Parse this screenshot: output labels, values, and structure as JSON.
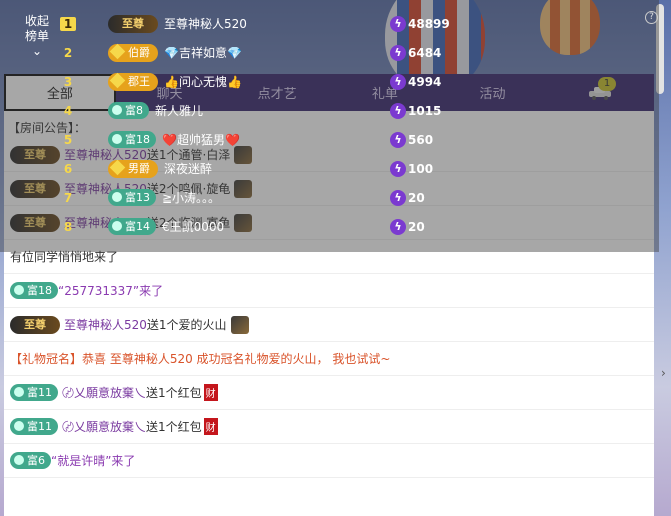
{
  "tabs": [
    {
      "label": "全部"
    },
    {
      "label": "聊天"
    },
    {
      "label": "点才艺"
    },
    {
      "label": "礼单"
    },
    {
      "label": "活动"
    },
    {
      "label": "",
      "badge": "1"
    }
  ],
  "announcement": "【房间公告】：",
  "overlay": {
    "collapse_label": "收起\n榜单",
    "rows": [
      {
        "rank": "1",
        "badge": "至尊",
        "badge_type": "zz",
        "name": "至尊神秘人520",
        "value": "48899"
      },
      {
        "rank": "2",
        "badge": "伯爵",
        "badge_type": "noble",
        "name": "💎吉祥如意💎",
        "value": "6484"
      },
      {
        "rank": "3",
        "badge": "郡王",
        "badge_type": "noble",
        "name": "👍问心无愧👍",
        "value": "4994"
      },
      {
        "rank": "4",
        "badge": "富8",
        "badge_type": "fu",
        "name": "新人雅儿",
        "value": "1015"
      },
      {
        "rank": "5",
        "badge": "富18",
        "badge_type": "fu",
        "name": "❤️超帅猛男❤️",
        "value": "560"
      },
      {
        "rank": "6",
        "badge": "男爵",
        "badge_type": "noble",
        "name": "深夜迷醉",
        "value": "100"
      },
      {
        "rank": "7",
        "badge": "富13",
        "badge_type": "fu",
        "name": "≧小涛。。。",
        "value": "20"
      },
      {
        "rank": "8",
        "badge": "富14",
        "badge_type": "fu",
        "name": "€王凯0000",
        "value": "20"
      }
    ]
  },
  "chat": [
    {
      "badge": "至尊",
      "badge_type": "zz",
      "name": "至尊神秘人520",
      "text": "送1个通管·白泽"
    },
    {
      "badge": "至尊",
      "badge_type": "zz",
      "name": "至尊神秘人520",
      "text": "送2个鸣佩·旋龟"
    },
    {
      "badge": "至尊",
      "badge_type": "zz",
      "name": "至尊神秘人520",
      "text": "送2个临渊·寡鱼"
    },
    {
      "type": "plain",
      "text": "有位同学悄悄地来了"
    },
    {
      "badge": "富18",
      "badge_type": "fu",
      "quote": "“257731337”来了"
    },
    {
      "badge": "至尊",
      "badge_type": "zz",
      "name": "至尊神秘人520",
      "text": "送1个爱的火山"
    },
    {
      "type": "gift",
      "text": "【礼物冠名】恭喜 至尊神秘人520 成功冠名礼物爱的火山， 我也试试~"
    },
    {
      "badge": "富11",
      "badge_type": "fu",
      "name": "〄乂願意放棄乀",
      "text": "送1个红包",
      "tag": "财"
    },
    {
      "badge": "富11",
      "badge_type": "fu",
      "name": "〄乂願意放棄乀",
      "text": "送1个红包",
      "tag": "财"
    },
    {
      "badge": "富6",
      "badge_type": "fu",
      "quote": "“就是许晴”来了"
    }
  ],
  "colors": {
    "tab_bar": "#3a2870",
    "accent_purple": "#7a3aa0",
    "gift_orange": "#d9532a",
    "fu_green": "#41a88c"
  }
}
